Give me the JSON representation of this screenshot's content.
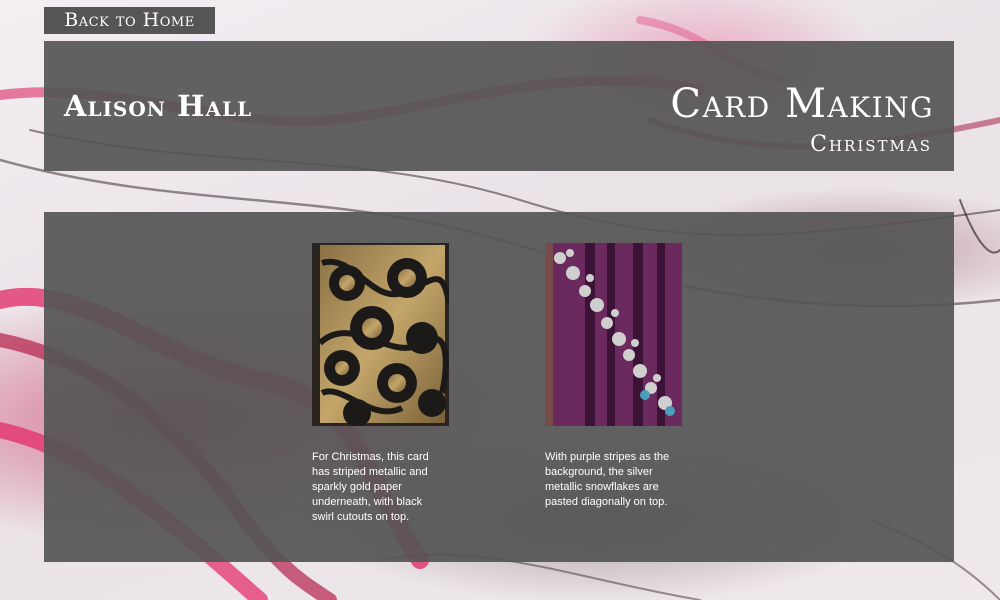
{
  "nav": {
    "back_label": "Back to Home"
  },
  "header": {
    "site_name": "Alison Hall",
    "title": "Card Making",
    "subtitle": "Christmas"
  },
  "cards": [
    {
      "caption": "For Christmas, this card has striped metallic and sparkly gold paper underneath, with black swirl cutouts on top."
    },
    {
      "caption": "With purple stripes as the background, the silver metallic snowflakes are pasted diagonally on top."
    }
  ],
  "colors": {
    "panel": "#555555",
    "text": "#ffffff",
    "accent_ink": "#c8144a",
    "card1_gold": "#b89a5a",
    "card2_purple": "#6a2a5e"
  }
}
